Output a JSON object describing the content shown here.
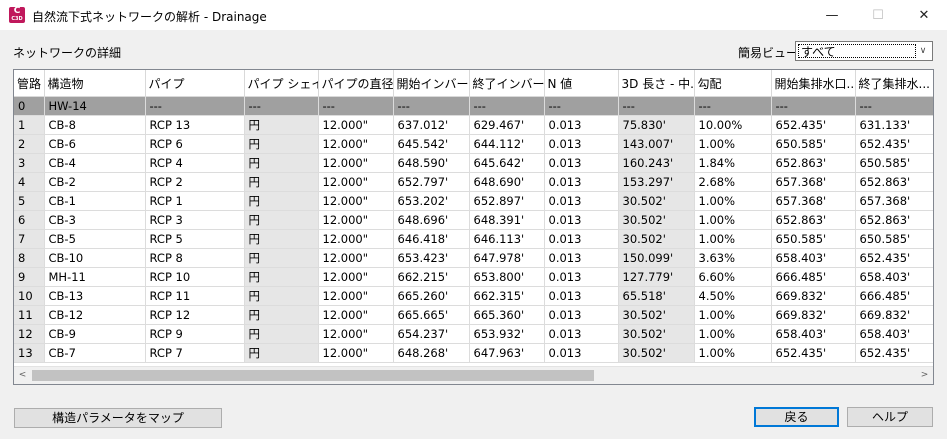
{
  "window": {
    "title": "自然流下式ネットワークの解析 - Drainage",
    "icon_text": "C",
    "icon_subtext": "C3D",
    "minimize_glyph": "—",
    "maximize_glyph": "☐",
    "close_glyph": "✕"
  },
  "section_label": "ネットワークの詳細",
  "view": {
    "label": "簡易ビュー",
    "value": "すべて"
  },
  "columns": [
    "管路",
    "構造物",
    "パイプ",
    "パイプ シェイプ",
    "パイプの直径",
    "開始インバー...",
    "終了インバー...",
    "N 値",
    "3D 長さ - 中...",
    "勾配",
    "開始集排水口...",
    "終了集排水..."
  ],
  "rows": [
    [
      "0",
      "HW-14",
      "---",
      "---",
      "---",
      "---",
      "---",
      "---",
      "---",
      "---",
      "---",
      "---"
    ],
    [
      "1",
      "CB-8",
      "RCP 13",
      "円",
      "12.000\"",
      "637.012'",
      "629.467'",
      "0.013",
      "75.830'",
      "10.00%",
      "652.435'",
      "631.133'"
    ],
    [
      "2",
      "CB-6",
      "RCP 6",
      "円",
      "12.000\"",
      "645.542'",
      "644.112'",
      "0.013",
      "143.007'",
      "1.00%",
      "650.585'",
      "652.435'"
    ],
    [
      "3",
      "CB-4",
      "RCP 4",
      "円",
      "12.000\"",
      "648.590'",
      "645.642'",
      "0.013",
      "160.243'",
      "1.84%",
      "652.863'",
      "650.585'"
    ],
    [
      "4",
      "CB-2",
      "RCP 2",
      "円",
      "12.000\"",
      "652.797'",
      "648.690'",
      "0.013",
      "153.297'",
      "2.68%",
      "657.368'",
      "652.863'"
    ],
    [
      "5",
      "CB-1",
      "RCP 1",
      "円",
      "12.000\"",
      "653.202'",
      "652.897'",
      "0.013",
      "30.502'",
      "1.00%",
      "657.368'",
      "657.368'"
    ],
    [
      "6",
      "CB-3",
      "RCP 3",
      "円",
      "12.000\"",
      "648.696'",
      "648.391'",
      "0.013",
      "30.502'",
      "1.00%",
      "652.863'",
      "652.863'"
    ],
    [
      "7",
      "CB-5",
      "RCP 5",
      "円",
      "12.000\"",
      "646.418'",
      "646.113'",
      "0.013",
      "30.502'",
      "1.00%",
      "650.585'",
      "650.585'"
    ],
    [
      "8",
      "CB-10",
      "RCP 8",
      "円",
      "12.000\"",
      "653.423'",
      "647.978'",
      "0.013",
      "150.099'",
      "3.63%",
      "658.403'",
      "652.435'"
    ],
    [
      "9",
      "MH-11",
      "RCP 10",
      "円",
      "12.000\"",
      "662.215'",
      "653.800'",
      "0.013",
      "127.779'",
      "6.60%",
      "666.485'",
      "658.403'"
    ],
    [
      "10",
      "CB-13",
      "RCP 11",
      "円",
      "12.000\"",
      "665.260'",
      "662.315'",
      "0.013",
      "65.518'",
      "4.50%",
      "669.832'",
      "666.485'"
    ],
    [
      "11",
      "CB-12",
      "RCP 12",
      "円",
      "12.000\"",
      "665.665'",
      "665.360'",
      "0.013",
      "30.502'",
      "1.00%",
      "669.832'",
      "669.832'"
    ],
    [
      "12",
      "CB-9",
      "RCP 9",
      "円",
      "12.000\"",
      "654.237'",
      "653.932'",
      "0.013",
      "30.502'",
      "1.00%",
      "658.403'",
      "658.403'"
    ],
    [
      "13",
      "CB-7",
      "RCP 7",
      "円",
      "12.000\"",
      "648.268'",
      "647.963'",
      "0.013",
      "30.502'",
      "1.00%",
      "652.435'",
      "652.435'"
    ]
  ],
  "selected_row": 0,
  "scroll": {
    "left_arrow": "<",
    "right_arrow": ">"
  },
  "buttons": {
    "map": "構造パラメータをマップ",
    "back": "戻る",
    "help": "ヘルプ"
  },
  "colors": {
    "app_icon": "#c0185c",
    "selected_row": "#a0a0a0",
    "readonly_cell": "#e6e6e6",
    "default_button_border": "#0078d7"
  }
}
